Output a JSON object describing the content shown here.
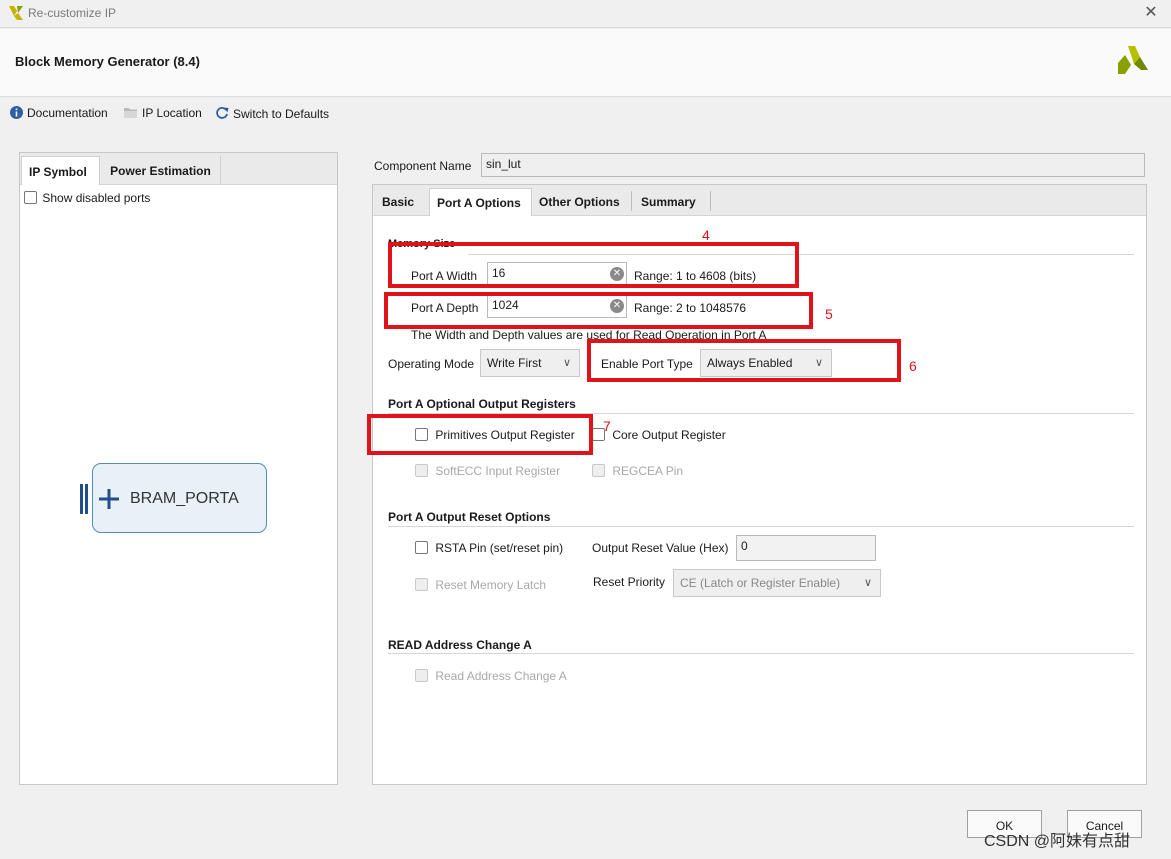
{
  "window": {
    "title": "Re-customize IP",
    "close_glyph": "✕"
  },
  "header": {
    "title": "Block Memory Generator (8.4)",
    "logo_icon": "xilinx-logo-icon"
  },
  "toolbar": {
    "documentation": "Documentation",
    "ip_location": "IP Location",
    "switch_defaults": "Switch to Defaults"
  },
  "left_panel": {
    "tabs": [
      "IP Symbol",
      "Power Estimation"
    ],
    "show_disabled_ports": "Show disabled ports",
    "symbol_port": "BRAM_PORTA"
  },
  "component": {
    "label": "Component Name",
    "value": "sin_lut"
  },
  "tabs": [
    "Basic",
    "Port A Options",
    "Other Options",
    "Summary"
  ],
  "memory_size": {
    "section": "Memory Size",
    "width_label": "Port A Width",
    "width_value": "16",
    "width_range": "Range: 1 to 4608 (bits)",
    "depth_label": "Port A Depth",
    "depth_value": "1024",
    "depth_range": "Range: 2 to 1048576",
    "note": "The Width and Depth values are used for Read Operation in Port A",
    "operating_mode_label": "Operating Mode",
    "operating_mode_value": "Write First",
    "enable_port_label": "Enable Port Type",
    "enable_port_value": "Always Enabled"
  },
  "optional_registers": {
    "section": "Port A Optional Output Registers",
    "primitives": "Primitives Output Register",
    "core": "Core Output Register",
    "softecc": "SoftECC Input Register",
    "regcea": "REGCEA Pin"
  },
  "reset_options": {
    "section": "Port A Output Reset Options",
    "rsta": "RSTA Pin (set/reset pin)",
    "output_reset_label": "Output Reset Value (Hex)",
    "output_reset_value": "0",
    "reset_latch": "Reset Memory Latch",
    "reset_priority_label": "Reset Priority",
    "reset_priority_value": "CE (Latch or Register Enable)"
  },
  "read_address": {
    "section": "READ Address Change A",
    "option": "Read Address Change A"
  },
  "annotations": [
    "4",
    "5",
    "6",
    "7"
  ],
  "buttons": {
    "ok": "OK",
    "cancel": "Cancel"
  },
  "watermark": "CSDN @阿妹有点甜",
  "colors": {
    "annotation_red": "#e0131a",
    "symbol_fill": "#e8f0f8",
    "symbol_border": "#5a8ab8",
    "symbol_accent": "#1f4e8c"
  }
}
